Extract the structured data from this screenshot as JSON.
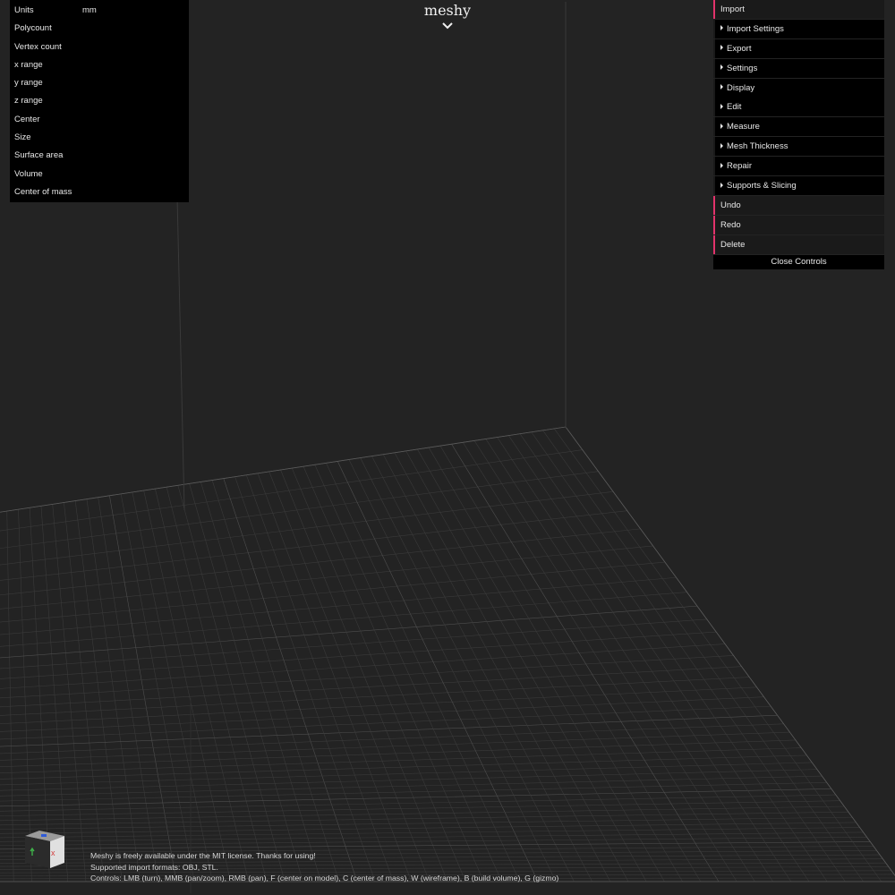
{
  "app": {
    "title": "meshy"
  },
  "info": {
    "rows": [
      {
        "label": "Units",
        "value": "mm"
      },
      {
        "label": "Polycount",
        "value": ""
      },
      {
        "label": "Vertex count",
        "value": ""
      },
      {
        "label": "x range",
        "value": ""
      },
      {
        "label": "y range",
        "value": ""
      },
      {
        "label": "z range",
        "value": ""
      },
      {
        "label": "Center",
        "value": ""
      },
      {
        "label": "Size",
        "value": ""
      },
      {
        "label": "Surface area",
        "value": ""
      },
      {
        "label": "Volume",
        "value": ""
      },
      {
        "label": "Center of mass",
        "value": ""
      }
    ]
  },
  "controls": {
    "items": [
      {
        "label": "Import",
        "kind": "button"
      },
      {
        "label": "Import Settings",
        "kind": "folder"
      },
      {
        "label": "Export",
        "kind": "folder"
      },
      {
        "label": "Settings",
        "kind": "folder"
      },
      {
        "label": "Display",
        "kind": "folder"
      },
      {
        "label": "Edit",
        "kind": "folder"
      },
      {
        "label": "Measure",
        "kind": "folder"
      },
      {
        "label": "Mesh Thickness",
        "kind": "folder"
      },
      {
        "label": "Repair",
        "kind": "folder"
      },
      {
        "label": "Supports & Slicing",
        "kind": "folder"
      },
      {
        "label": "Undo",
        "kind": "button"
      },
      {
        "label": "Redo",
        "kind": "button"
      },
      {
        "label": "Delete",
        "kind": "button"
      }
    ],
    "close_label": "Close Controls",
    "accent_color": "#e2336b"
  },
  "gizmo": {
    "x_label": "x",
    "x_color": "#d23c3c",
    "y_color": "#3fb04a",
    "z_color": "#2f5bd8"
  },
  "footer": {
    "lines": [
      "Meshy is freely available under the MIT license. Thanks for using!",
      "Supported import formats: OBJ, STL.",
      "Controls: LMB (turn), MMB (pan/zoom), RMB (pan), F (center on model), C (center of mass), W (wireframe), B (build volume), G (gizmo)"
    ]
  },
  "colors": {
    "background": "#232323",
    "panel": "#000000",
    "grid": "#4a4a4a"
  }
}
